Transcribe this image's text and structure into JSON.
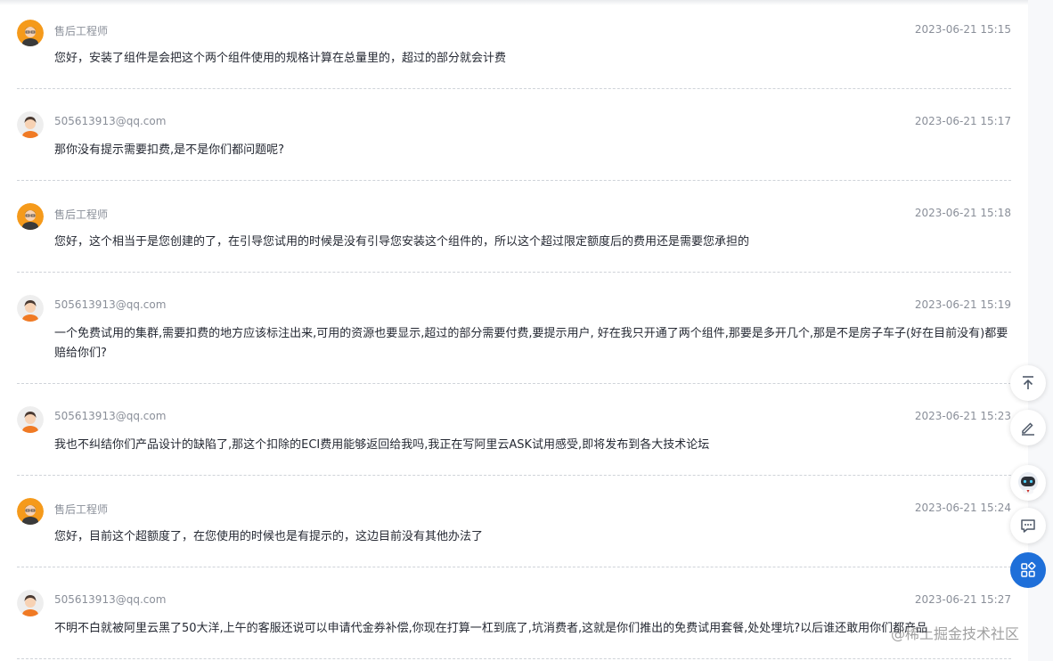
{
  "comments": [
    {
      "author": "售后工程师",
      "time": "2023-06-21 15:15",
      "text": "您好，安装了组件是会把这个两个组件使用的规格计算在总量里的，超过的部分就会计费",
      "avatar": "engineer-avatar"
    },
    {
      "author": "505613913@qq.com",
      "time": "2023-06-21 15:17",
      "text": "那你没有提示需要扣费,是不是你们都问题呢?",
      "avatar": "user-avatar"
    },
    {
      "author": "售后工程师",
      "time": "2023-06-21 15:18",
      "text": "您好，这个相当于是您创建的了，在引导您试用的时候是没有引导您安装这个组件的，所以这个超过限定额度后的费用还是需要您承担的",
      "avatar": "engineer-avatar"
    },
    {
      "author": "505613913@qq.com",
      "time": "2023-06-21 15:19",
      "text": "一个免费试用的集群,需要扣费的地方应该标注出来,可用的资源也要显示,超过的部分需要付费,要提示用户, 好在我只开通了两个组件,那要是多开几个,那是不是房子车子(好在目前没有)都要赔给你们?",
      "avatar": "user-avatar"
    },
    {
      "author": "505613913@qq.com",
      "time": "2023-06-21 15:23",
      "text": "我也不纠结你们产品设计的缺陷了,那这个扣除的ECI费用能够返回给我吗,我正在写阿里云ASK试用感受,即将发布到各大技术论坛",
      "avatar": "user-avatar"
    },
    {
      "author": "售后工程师",
      "time": "2023-06-21 15:24",
      "text": "您好，目前这个超额度了，在您使用的时候也是有提示的，这边目前没有其他办法了",
      "avatar": "engineer-avatar"
    },
    {
      "author": "505613913@qq.com",
      "time": "2023-06-21 15:27",
      "text": "不明不白就被阿里云黑了50大洋,上午的客服还说可以申请代金券补偿,你现在打算一杠到底了,坑消费者,这就是你们推出的免费试用套餐,处处埋坑?以后谁还敢用你们都产品",
      "avatar": "user-avatar"
    }
  ],
  "watermark": "@稀土掘金技术社区",
  "float_toolbar": [
    "back-to-top-icon",
    "edit-icon",
    "robot-assistant-icon",
    "comment-icon",
    "apps-icon"
  ],
  "colors": {
    "accent": "#1e6fd9",
    "meta_text": "#8a8f99",
    "body_text": "#252933",
    "divider": "#cfd3d9"
  }
}
